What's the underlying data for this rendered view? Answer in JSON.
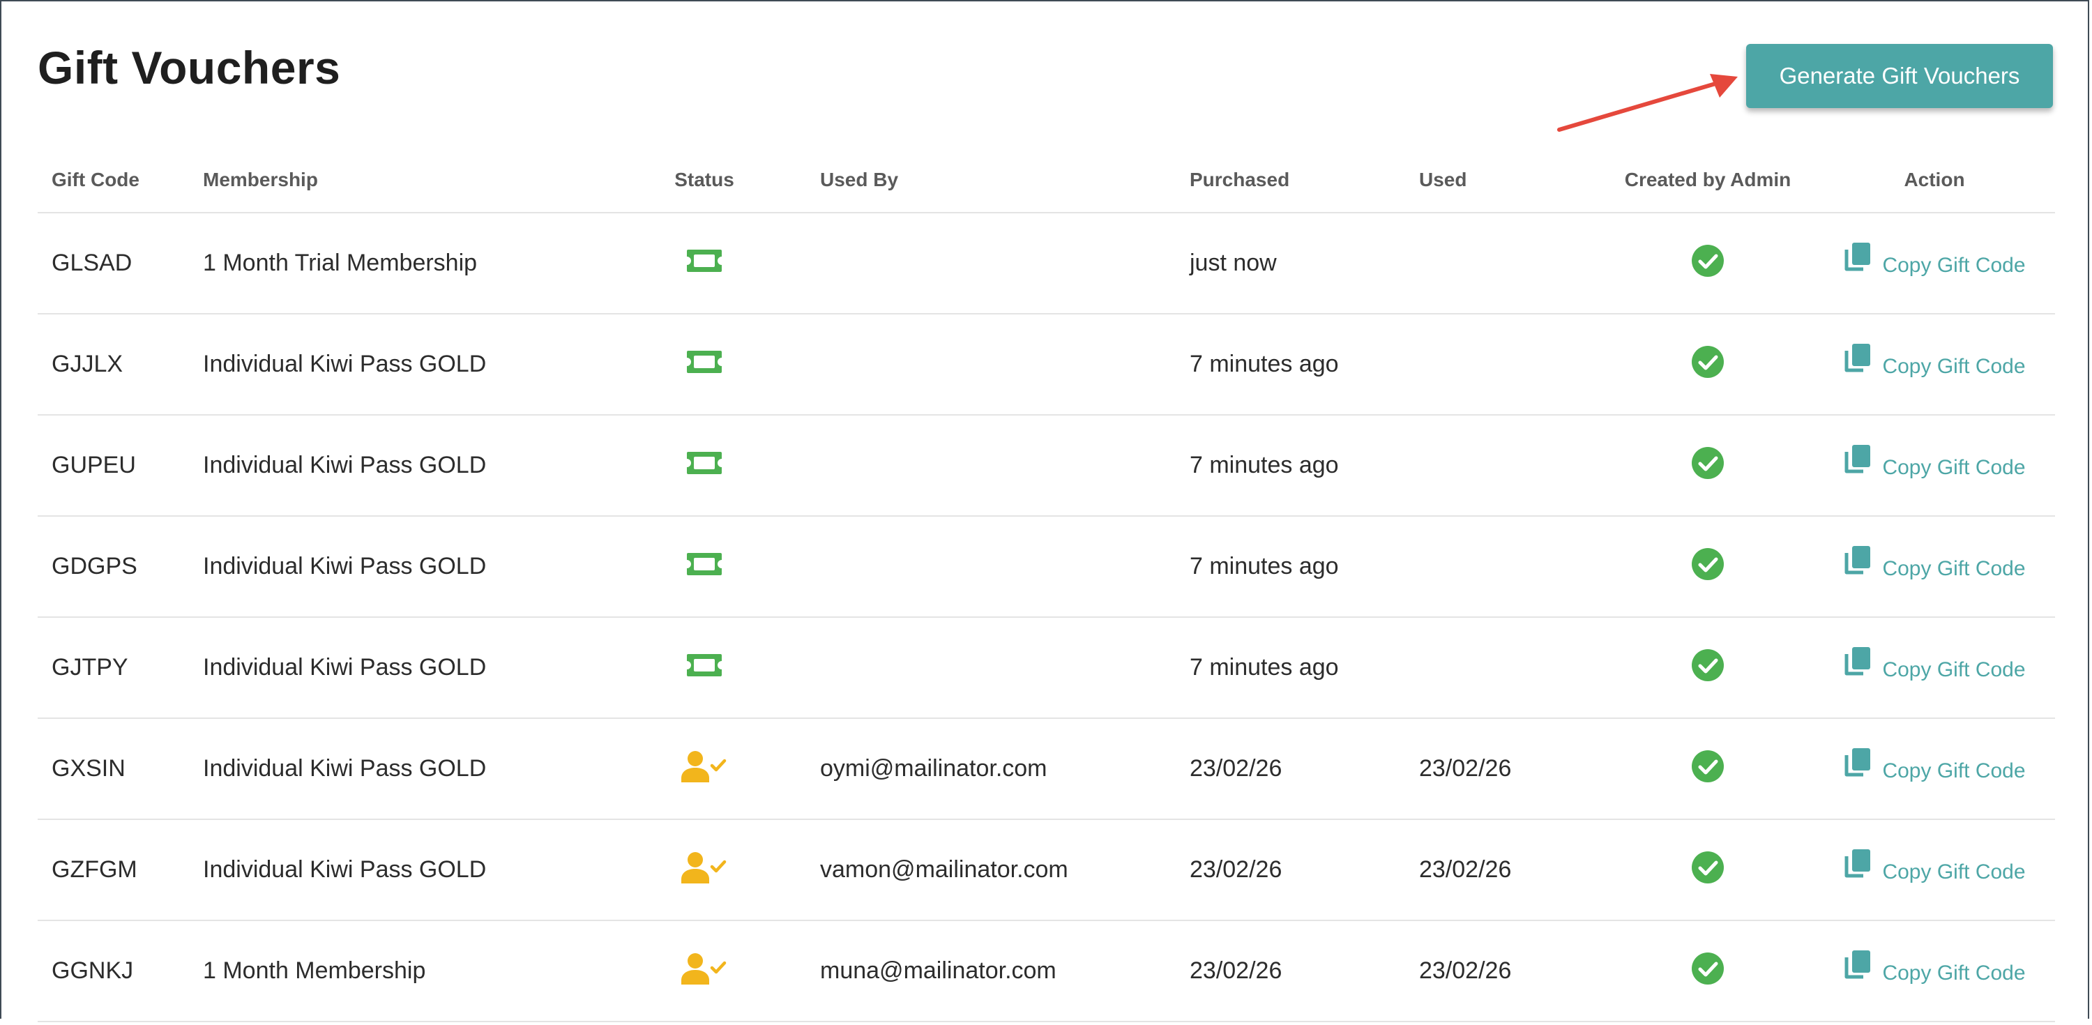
{
  "page": {
    "title": "Gift Vouchers",
    "generate_button_label": "Generate Gift Vouchers"
  },
  "colors": {
    "accent_teal": "#4da6a6",
    "status_available_green": "#4cb050",
    "status_used_yellow": "#f2b51c",
    "admin_check_green": "#4cb050",
    "annotation_arrow_red": "#e5483c"
  },
  "table": {
    "columns": [
      "Gift Code",
      "Membership",
      "Status",
      "Used By",
      "Purchased",
      "Used",
      "Created by Admin",
      "Action"
    ],
    "rows": [
      {
        "code": "GLSAD",
        "membership": "1 Month Trial Membership",
        "status_icon": "ticket-icon",
        "used_by": "",
        "purchased": "just now",
        "used": "",
        "admin_icon": "check-circle-icon",
        "action": "Copy Gift Code"
      },
      {
        "code": "GJJLX",
        "membership": "Individual Kiwi Pass GOLD",
        "status_icon": "ticket-icon",
        "used_by": "",
        "purchased": "7 minutes ago",
        "used": "",
        "admin_icon": "check-circle-icon",
        "action": "Copy Gift Code"
      },
      {
        "code": "GUPEU",
        "membership": "Individual Kiwi Pass GOLD",
        "status_icon": "ticket-icon",
        "used_by": "",
        "purchased": "7 minutes ago",
        "used": "",
        "admin_icon": "check-circle-icon",
        "action": "Copy Gift Code"
      },
      {
        "code": "GDGPS",
        "membership": "Individual Kiwi Pass GOLD",
        "status_icon": "ticket-icon",
        "used_by": "",
        "purchased": "7 minutes ago",
        "used": "",
        "admin_icon": "check-circle-icon",
        "action": "Copy Gift Code"
      },
      {
        "code": "GJTPY",
        "membership": "Individual Kiwi Pass GOLD",
        "status_icon": "ticket-icon",
        "used_by": "",
        "purchased": "7 minutes ago",
        "used": "",
        "admin_icon": "check-circle-icon",
        "action": "Copy Gift Code"
      },
      {
        "code": "GXSIN",
        "membership": "Individual Kiwi Pass GOLD",
        "status_icon": "user-check-icon",
        "used_by": "oymi@mailinator.com",
        "purchased": "23/02/26",
        "used": "23/02/26",
        "admin_icon": "check-circle-icon",
        "action": "Copy Gift Code"
      },
      {
        "code": "GZFGM",
        "membership": "Individual Kiwi Pass GOLD",
        "status_icon": "user-check-icon",
        "used_by": "vamon@mailinator.com",
        "purchased": "23/02/26",
        "used": "23/02/26",
        "admin_icon": "check-circle-icon",
        "action": "Copy Gift Code"
      },
      {
        "code": "GGNKJ",
        "membership": "1 Month Membership",
        "status_icon": "user-check-icon",
        "used_by": "muna@mailinator.com",
        "purchased": "23/02/26",
        "used": "23/02/26",
        "admin_icon": "check-circle-icon",
        "action": "Copy Gift Code"
      }
    ]
  }
}
